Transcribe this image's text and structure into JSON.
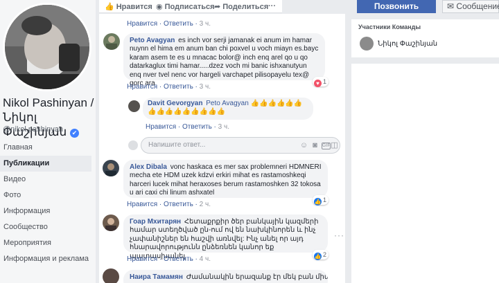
{
  "profile": {
    "name": "Nikol Pashinyan / Նիկոլ Փաշինյան",
    "handle": "@nikol.pashinyan",
    "verified_mark": "✔"
  },
  "nav": [
    "Главная",
    "Публикации",
    "Видео",
    "Фото",
    "Информация",
    "Сообщество",
    "Мероприятия",
    "Информация и реклама"
  ],
  "topbar": {
    "like": "Нравится",
    "subscribe": "Подписаться",
    "share": "Поделиться",
    "more": "···",
    "like_icon": "thumbs-up-icon",
    "subscribe_icon": "rss-icon",
    "share_icon": "share-arrow-icon"
  },
  "actions": {
    "call": "Позвонить",
    "message": "Сообщение",
    "message_icon": "messenger-icon"
  },
  "team": {
    "title": "Участники Команды",
    "member": "Նիկոլ Փաշինյան"
  },
  "comments": [
    {
      "author": "",
      "text": "",
      "like": "Нравится",
      "reply": "Ответить",
      "time": "3 ч."
    },
    {
      "author": "Peto Avagyan",
      "text": "es inch vor serji jamanak ei anum im hamar nuynn el hima em anum ban chi poxvel u voch miayn es.bayc karam asem te es u mnacac bolor@ inch enq arel qo u qo datarkaglux timi hamar.....dzez voch mi banic ishxanutyun enq nver tvel nenc vor hargeli varchapet pilisopayelu tex@ gorc ara",
      "like": "Нравится",
      "reply": "Ответить",
      "time": "3 ч.",
      "reactions": "1",
      "reaction_color": "#f25268"
    },
    {
      "author": "Davit Gevorgyan",
      "mention": "Peto Avagyan",
      "text": "👍👍👍👍👍👍👍👍👍👍👍👍👍👍👍",
      "like": "Нравится",
      "reply": "Ответить",
      "time": "3 ч."
    },
    {
      "author": "Alex Dibala",
      "text": "vonc haskaca es mer sax problemneri HDMNERI mecha ete HDM uzek kdzvi erkiri mihat es rastamoshkeqi harceri lucek mihat heraxoses berum rastamoshken 32 tokosa u ari caxi chi linum ashxatel",
      "like": "Нравится",
      "reply": "Ответить",
      "time": "2 ч.",
      "reactions": "1",
      "reaction_color": "#1877f2"
    },
    {
      "author": "Гоар Мхитарян",
      "text": "Հետաքրքիր ծեր բանկային կազմերի համար ստեղծված ըն-ում ով են նախկինորեն և ինչ չափանիշներ են հաշվի առնվել: Ինչ անել որ այդ հնարավորությունն ընձեռնեն կանոր եք պատասխանել",
      "like": "Нравится",
      "reply": "Ответить",
      "time": "4 ч.",
      "reactions": "2",
      "reaction_color": "#1877f2"
    },
    {
      "author": "Наира Тамамян",
      "text": "Ժամանակին երազանք էր մեկ բան միայն, որ"
    }
  ],
  "reply_box": {
    "placeholder": "Напишите ответ...",
    "emoji_icon": "smiley-icon",
    "camera_icon": "camera-icon",
    "gif_label": "GIF",
    "sticker_icon": "sticker-icon"
  },
  "more_dots": "···"
}
